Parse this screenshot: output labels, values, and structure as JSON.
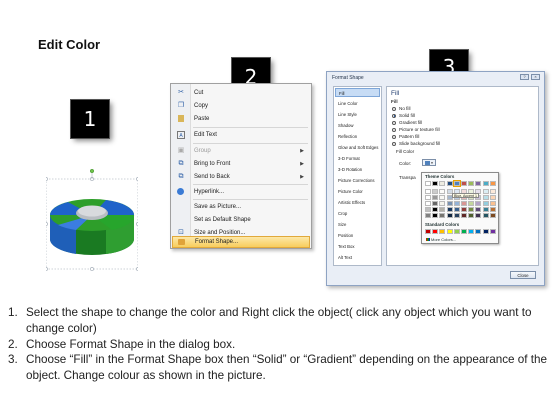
{
  "title": "Edit Color",
  "step_numbers": [
    "1",
    "2",
    "3"
  ],
  "context_menu": {
    "items": [
      {
        "label": "Cut",
        "icon": "scissors-icon",
        "glyph": "✂",
        "disabled": false
      },
      {
        "label": "Copy",
        "icon": "copy-icon",
        "glyph": "❐",
        "disabled": false
      },
      {
        "label": "Paste",
        "icon": "paste-icon",
        "glyph": "📋",
        "disabled": false
      },
      {
        "label": "Edit Text",
        "icon": "edit-text-icon",
        "glyph": "A",
        "disabled": false
      },
      {
        "label": "Group",
        "icon": "group-icon",
        "glyph": "▣",
        "disabled": true,
        "submenu": true
      },
      {
        "label": "Bring to Front",
        "icon": "bring-front-icon",
        "glyph": "⧉",
        "disabled": false,
        "submenu": true
      },
      {
        "label": "Send to Back",
        "icon": "send-back-icon",
        "glyph": "⧉",
        "disabled": false,
        "submenu": true
      },
      {
        "label": "Hyperlink...",
        "icon": "hyperlink-icon",
        "glyph": "🌐",
        "disabled": false
      },
      {
        "label": "Save as Picture...",
        "icon": "",
        "glyph": "",
        "disabled": false
      },
      {
        "label": "Set as Default Shape",
        "icon": "",
        "glyph": "",
        "disabled": false
      },
      {
        "label": "Size and Position...",
        "icon": "size-position-icon",
        "glyph": "⊡",
        "disabled": false
      },
      {
        "label": "Format Shape...",
        "icon": "format-shape-icon",
        "glyph": "🖌",
        "disabled": false,
        "highlighted": true
      }
    ]
  },
  "format_dialog": {
    "title": "Format Shape",
    "window_controls": [
      "?",
      "×"
    ],
    "categories": [
      "Fill",
      "Line Color",
      "Line Style",
      "Shadow",
      "Reflection",
      "Glow and Soft Edges",
      "3-D Format",
      "3-D Rotation",
      "Picture Corrections",
      "Picture Color",
      "Artistic Effects",
      "Crop",
      "Size",
      "Position",
      "Text Box",
      "Alt Text"
    ],
    "selected_category": "Fill",
    "panel_heading": "Fill",
    "fill_options": [
      {
        "label": "No fill",
        "checked": false
      },
      {
        "label": "Solid fill",
        "checked": true
      },
      {
        "label": "Gradient fill",
        "checked": false
      },
      {
        "label": "Picture or texture fill",
        "checked": false
      },
      {
        "label": "Pattern fill",
        "checked": false
      },
      {
        "label": "Slide background fill",
        "checked": false
      }
    ],
    "fill_color_label": "Fill Color",
    "color_label": "Color:",
    "transparency_label": "Transpa",
    "close_label": "Close"
  },
  "color_picker": {
    "theme_label": "Theme Colors",
    "standard_label": "Standard Colors",
    "more_label": "More Colors...",
    "tooltip": "Blue, Accent 1",
    "theme_top": [
      "#ffffff",
      "#000000",
      "#eeece1",
      "#1f497d",
      "#4f81bd",
      "#c0504d",
      "#9bbb59",
      "#8064a2",
      "#4bacc6",
      "#f79646"
    ],
    "standard": [
      "#c00000",
      "#ff0000",
      "#ffc000",
      "#ffff00",
      "#92d050",
      "#00b050",
      "#00b0f0",
      "#0070c0",
      "#002060",
      "#7030a0"
    ]
  },
  "instructions": [
    {
      "n": "1.",
      "text": "Select the shape to change the color and Right click the object( click any object which you want to change color)"
    },
    {
      "n": "2.",
      "text": "Choose Format Shape in the dialog box."
    },
    {
      "n": "3.",
      "text": "Choose “Fill” in the Format Shape box then “Solid” or “Gradient” depending on the appearance of the object. Change colour as shown in the picture."
    }
  ],
  "colors": {
    "cylinder_green": "#2e9e2a",
    "cylinder_blue": "#1f63c9",
    "menu_highlight": "#f8cd5c"
  }
}
